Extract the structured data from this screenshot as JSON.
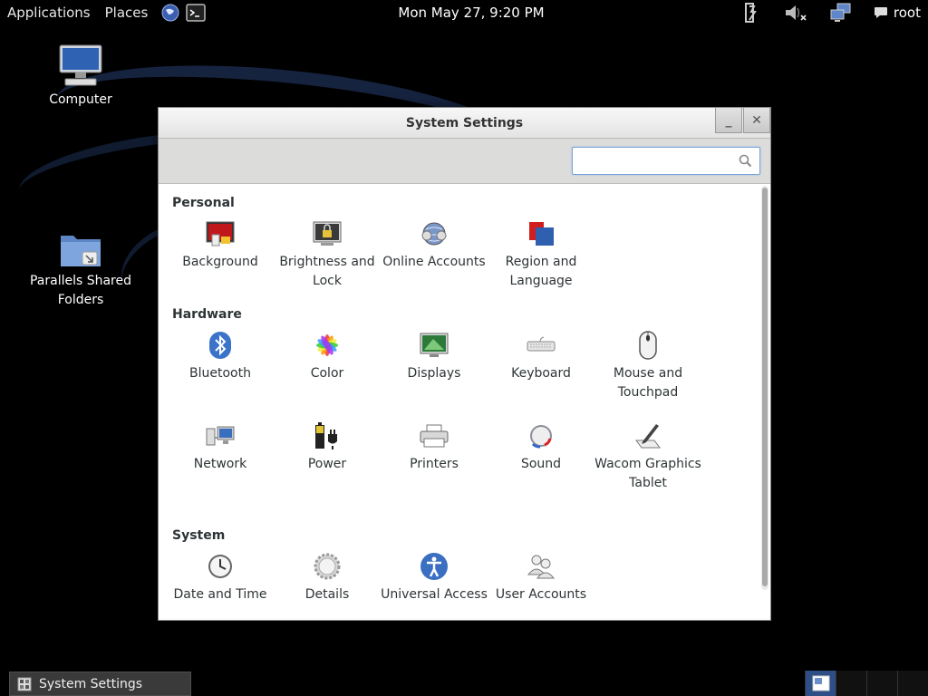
{
  "topbar": {
    "applications": "Applications",
    "places": "Places",
    "clock": "Mon May 27,  9:20 PM",
    "user": "root"
  },
  "desktop": {
    "computer": "Computer",
    "shared_folders": "Parallels Shared Folders"
  },
  "window": {
    "title": "System Settings",
    "minimize_label": "_",
    "close_label": "✕",
    "search_placeholder": "",
    "sections": {
      "personal": "Personal",
      "hardware": "Hardware",
      "system": "System"
    },
    "items": {
      "background": "Background",
      "brightness": "Brightness and Lock",
      "online_accounts": "Online Accounts",
      "region": "Region and Language",
      "bluetooth": "Bluetooth",
      "color": "Color",
      "displays": "Displays",
      "keyboard": "Keyboard",
      "mouse": "Mouse and Touchpad",
      "network": "Network",
      "power": "Power",
      "printers": "Printers",
      "sound": "Sound",
      "wacom": "Wacom Graphics Tablet",
      "datetime": "Date and Time",
      "details": "Details",
      "universal_access": "Universal Access",
      "user_accounts": "User Accounts"
    }
  },
  "taskbar": {
    "task_label": "System Settings"
  },
  "colors": {
    "workspace_active": "#2d4f86",
    "search_border": "#7aa3d6"
  }
}
